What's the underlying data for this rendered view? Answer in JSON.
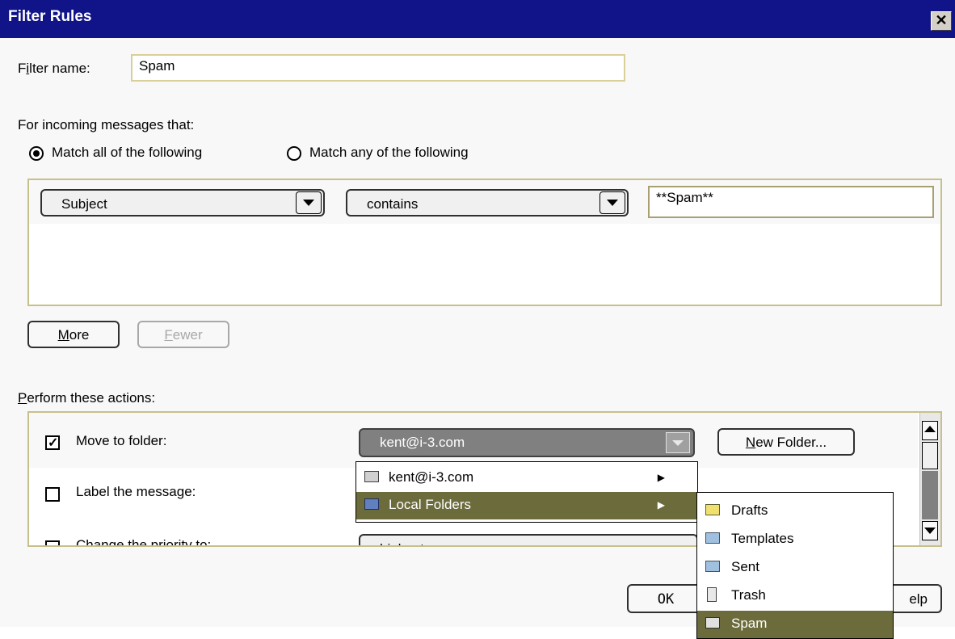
{
  "window": {
    "title": "Filter Rules",
    "close_glyph": "✕"
  },
  "filter_name": {
    "label_pre": "F",
    "label_u": "i",
    "label_post": "lter name:",
    "value": "Spam"
  },
  "incoming_label": "For incoming messages that:",
  "match_all": {
    "label": "Match all of the following",
    "selected": true
  },
  "match_any": {
    "label": "Match any of the following",
    "selected": false
  },
  "criteria": [
    {
      "field": "Subject",
      "operator": "contains",
      "value": "**Spam**"
    }
  ],
  "more_button": {
    "u": "M",
    "rest": "ore"
  },
  "fewer_button": {
    "u": "F",
    "rest": "ewer"
  },
  "actions_label": {
    "u": "P",
    "rest": "erform these actions:"
  },
  "actions": {
    "move": {
      "label": "Move to folder:",
      "checked": true,
      "selected_folder": "kent@i-3.com"
    },
    "label_msg": {
      "label": "Label the message:",
      "checked": false
    },
    "priority": {
      "label": "Change the priority to:",
      "checked": false,
      "value": "highest"
    }
  },
  "new_folder_button": {
    "u": "N",
    "rest": "ew Folder..."
  },
  "folder_menu": [
    {
      "label": "kent@i-3.com",
      "icon": "mail-account-icon",
      "highlighted": false
    },
    {
      "label": "Local Folders",
      "icon": "local-folders-icon",
      "highlighted": true
    }
  ],
  "submenu": [
    {
      "label": "Drafts",
      "icon": "drafts-icon",
      "highlighted": false
    },
    {
      "label": "Templates",
      "icon": "templates-icon",
      "highlighted": false
    },
    {
      "label": "Sent",
      "icon": "sent-icon",
      "highlighted": false
    },
    {
      "label": "Trash",
      "icon": "trash-icon",
      "highlighted": false
    },
    {
      "label": "Spam",
      "icon": "folder-icon",
      "highlighted": true
    }
  ],
  "ok_button": "OK",
  "help_button_visible": "elp",
  "colors": {
    "titlebar": "#101488",
    "highlight": "#6b6b3c",
    "panel_border": "#c8c08a"
  }
}
